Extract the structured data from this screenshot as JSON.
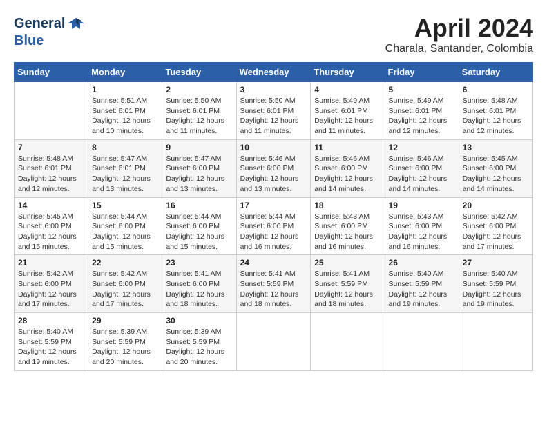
{
  "header": {
    "logo_general": "General",
    "logo_blue": "Blue",
    "month_title": "April 2024",
    "location": "Charala, Santander, Colombia"
  },
  "calendar": {
    "days_of_week": [
      "Sunday",
      "Monday",
      "Tuesday",
      "Wednesday",
      "Thursday",
      "Friday",
      "Saturday"
    ],
    "weeks": [
      [
        {
          "day": "",
          "sunrise": "",
          "sunset": "",
          "daylight": ""
        },
        {
          "day": "1",
          "sunrise": "Sunrise: 5:51 AM",
          "sunset": "Sunset: 6:01 PM",
          "daylight": "Daylight: 12 hours and 10 minutes."
        },
        {
          "day": "2",
          "sunrise": "Sunrise: 5:50 AM",
          "sunset": "Sunset: 6:01 PM",
          "daylight": "Daylight: 12 hours and 11 minutes."
        },
        {
          "day": "3",
          "sunrise": "Sunrise: 5:50 AM",
          "sunset": "Sunset: 6:01 PM",
          "daylight": "Daylight: 12 hours and 11 minutes."
        },
        {
          "day": "4",
          "sunrise": "Sunrise: 5:49 AM",
          "sunset": "Sunset: 6:01 PM",
          "daylight": "Daylight: 12 hours and 11 minutes."
        },
        {
          "day": "5",
          "sunrise": "Sunrise: 5:49 AM",
          "sunset": "Sunset: 6:01 PM",
          "daylight": "Daylight: 12 hours and 12 minutes."
        },
        {
          "day": "6",
          "sunrise": "Sunrise: 5:48 AM",
          "sunset": "Sunset: 6:01 PM",
          "daylight": "Daylight: 12 hours and 12 minutes."
        }
      ],
      [
        {
          "day": "7",
          "sunrise": "Sunrise: 5:48 AM",
          "sunset": "Sunset: 6:01 PM",
          "daylight": "Daylight: 12 hours and 12 minutes."
        },
        {
          "day": "8",
          "sunrise": "Sunrise: 5:47 AM",
          "sunset": "Sunset: 6:01 PM",
          "daylight": "Daylight: 12 hours and 13 minutes."
        },
        {
          "day": "9",
          "sunrise": "Sunrise: 5:47 AM",
          "sunset": "Sunset: 6:00 PM",
          "daylight": "Daylight: 12 hours and 13 minutes."
        },
        {
          "day": "10",
          "sunrise": "Sunrise: 5:46 AM",
          "sunset": "Sunset: 6:00 PM",
          "daylight": "Daylight: 12 hours and 13 minutes."
        },
        {
          "day": "11",
          "sunrise": "Sunrise: 5:46 AM",
          "sunset": "Sunset: 6:00 PM",
          "daylight": "Daylight: 12 hours and 14 minutes."
        },
        {
          "day": "12",
          "sunrise": "Sunrise: 5:46 AM",
          "sunset": "Sunset: 6:00 PM",
          "daylight": "Daylight: 12 hours and 14 minutes."
        },
        {
          "day": "13",
          "sunrise": "Sunrise: 5:45 AM",
          "sunset": "Sunset: 6:00 PM",
          "daylight": "Daylight: 12 hours and 14 minutes."
        }
      ],
      [
        {
          "day": "14",
          "sunrise": "Sunrise: 5:45 AM",
          "sunset": "Sunset: 6:00 PM",
          "daylight": "Daylight: 12 hours and 15 minutes."
        },
        {
          "day": "15",
          "sunrise": "Sunrise: 5:44 AM",
          "sunset": "Sunset: 6:00 PM",
          "daylight": "Daylight: 12 hours and 15 minutes."
        },
        {
          "day": "16",
          "sunrise": "Sunrise: 5:44 AM",
          "sunset": "Sunset: 6:00 PM",
          "daylight": "Daylight: 12 hours and 15 minutes."
        },
        {
          "day": "17",
          "sunrise": "Sunrise: 5:44 AM",
          "sunset": "Sunset: 6:00 PM",
          "daylight": "Daylight: 12 hours and 16 minutes."
        },
        {
          "day": "18",
          "sunrise": "Sunrise: 5:43 AM",
          "sunset": "Sunset: 6:00 PM",
          "daylight": "Daylight: 12 hours and 16 minutes."
        },
        {
          "day": "19",
          "sunrise": "Sunrise: 5:43 AM",
          "sunset": "Sunset: 6:00 PM",
          "daylight": "Daylight: 12 hours and 16 minutes."
        },
        {
          "day": "20",
          "sunrise": "Sunrise: 5:42 AM",
          "sunset": "Sunset: 6:00 PM",
          "daylight": "Daylight: 12 hours and 17 minutes."
        }
      ],
      [
        {
          "day": "21",
          "sunrise": "Sunrise: 5:42 AM",
          "sunset": "Sunset: 6:00 PM",
          "daylight": "Daylight: 12 hours and 17 minutes."
        },
        {
          "day": "22",
          "sunrise": "Sunrise: 5:42 AM",
          "sunset": "Sunset: 6:00 PM",
          "daylight": "Daylight: 12 hours and 17 minutes."
        },
        {
          "day": "23",
          "sunrise": "Sunrise: 5:41 AM",
          "sunset": "Sunset: 6:00 PM",
          "daylight": "Daylight: 12 hours and 18 minutes."
        },
        {
          "day": "24",
          "sunrise": "Sunrise: 5:41 AM",
          "sunset": "Sunset: 5:59 PM",
          "daylight": "Daylight: 12 hours and 18 minutes."
        },
        {
          "day": "25",
          "sunrise": "Sunrise: 5:41 AM",
          "sunset": "Sunset: 5:59 PM",
          "daylight": "Daylight: 12 hours and 18 minutes."
        },
        {
          "day": "26",
          "sunrise": "Sunrise: 5:40 AM",
          "sunset": "Sunset: 5:59 PM",
          "daylight": "Daylight: 12 hours and 19 minutes."
        },
        {
          "day": "27",
          "sunrise": "Sunrise: 5:40 AM",
          "sunset": "Sunset: 5:59 PM",
          "daylight": "Daylight: 12 hours and 19 minutes."
        }
      ],
      [
        {
          "day": "28",
          "sunrise": "Sunrise: 5:40 AM",
          "sunset": "Sunset: 5:59 PM",
          "daylight": "Daylight: 12 hours and 19 minutes."
        },
        {
          "day": "29",
          "sunrise": "Sunrise: 5:39 AM",
          "sunset": "Sunset: 5:59 PM",
          "daylight": "Daylight: 12 hours and 20 minutes."
        },
        {
          "day": "30",
          "sunrise": "Sunrise: 5:39 AM",
          "sunset": "Sunset: 5:59 PM",
          "daylight": "Daylight: 12 hours and 20 minutes."
        },
        {
          "day": "",
          "sunrise": "",
          "sunset": "",
          "daylight": ""
        },
        {
          "day": "",
          "sunrise": "",
          "sunset": "",
          "daylight": ""
        },
        {
          "day": "",
          "sunrise": "",
          "sunset": "",
          "daylight": ""
        },
        {
          "day": "",
          "sunrise": "",
          "sunset": "",
          "daylight": ""
        }
      ]
    ]
  }
}
